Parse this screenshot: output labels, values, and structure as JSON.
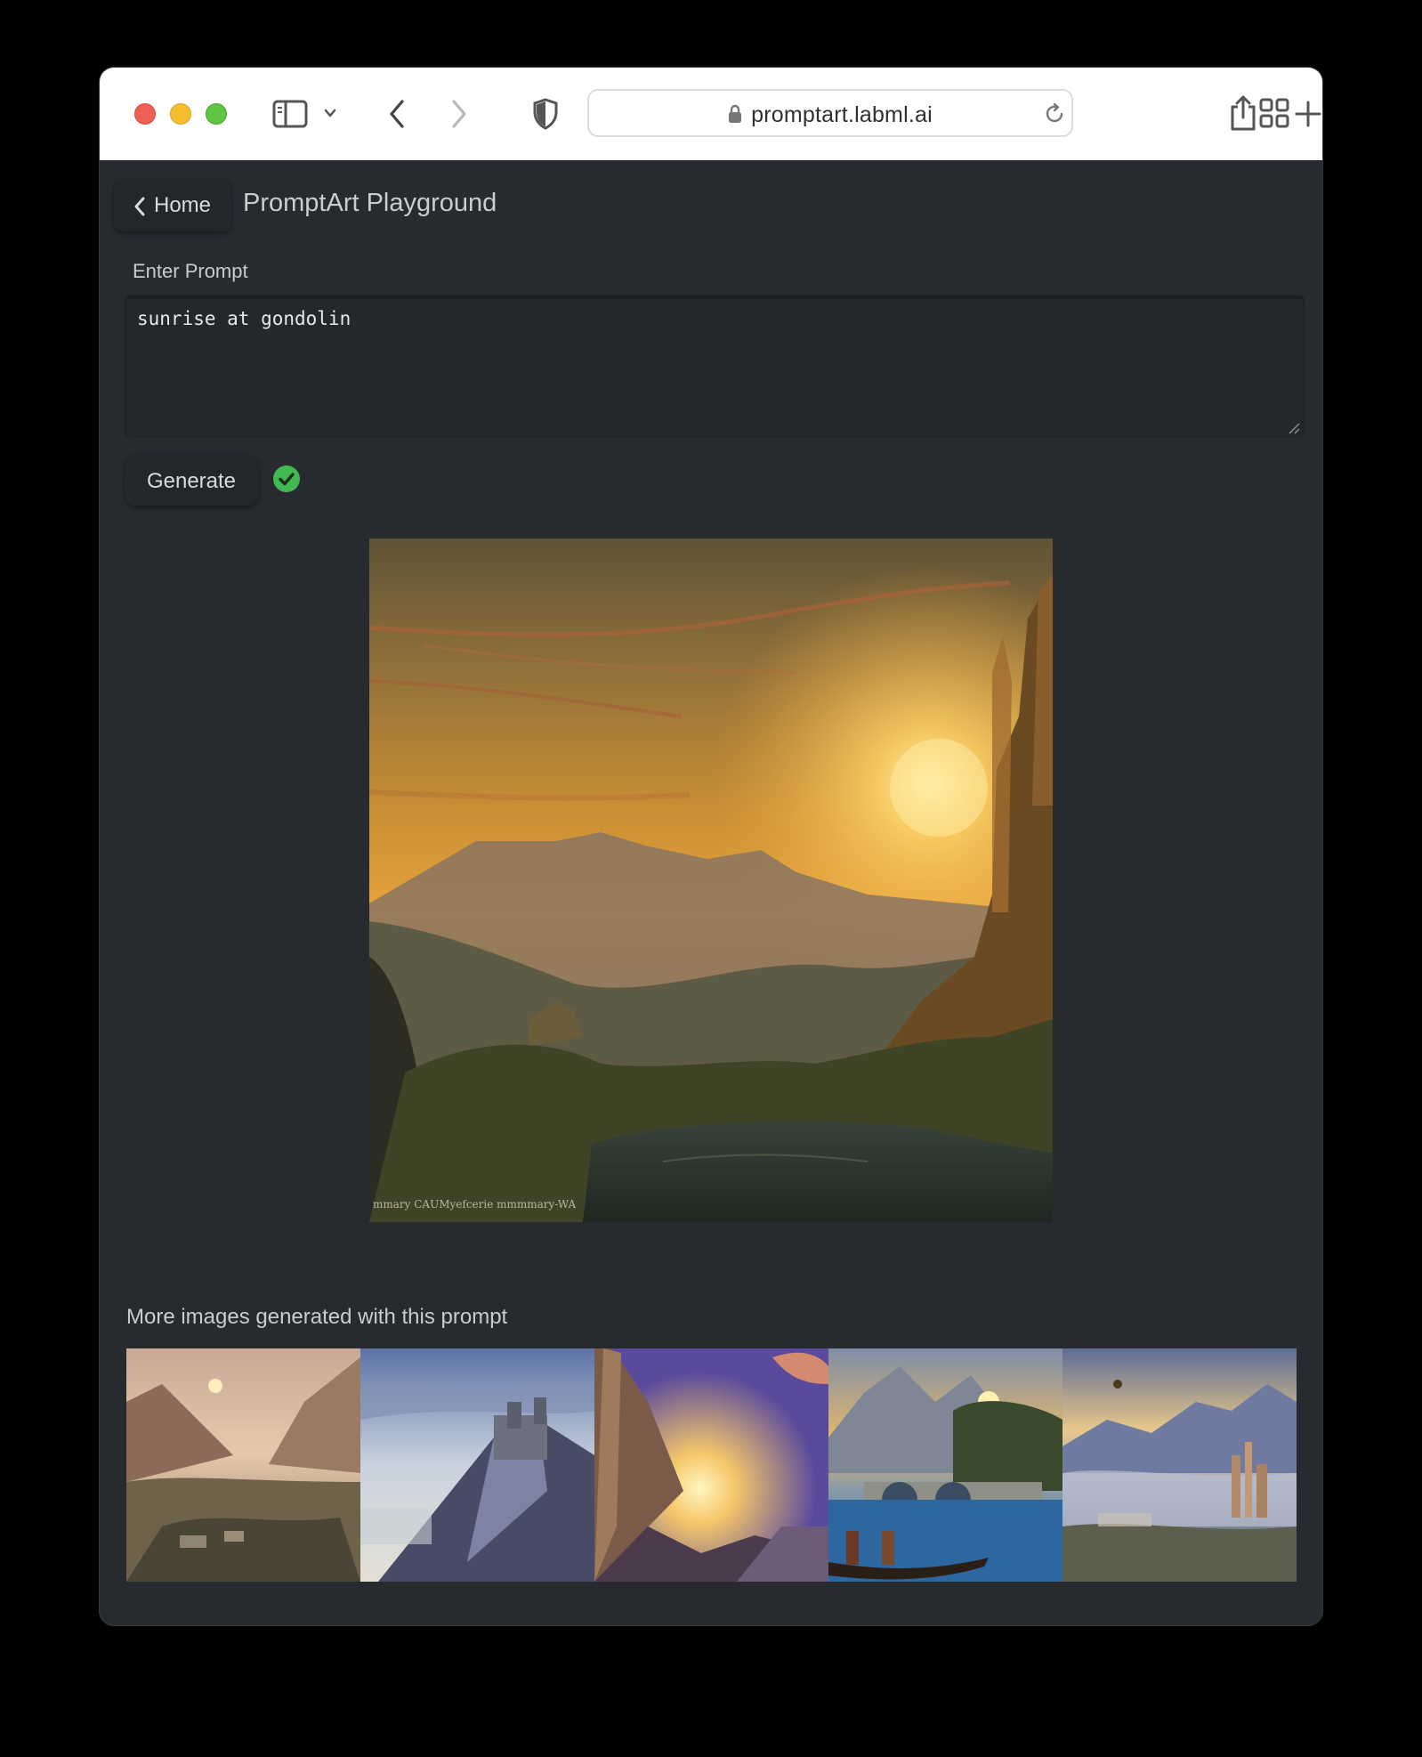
{
  "browser": {
    "url": "promptart.labml.ai"
  },
  "nav": {
    "back_label": "Home",
    "title": "PromptArt Playground"
  },
  "prompt": {
    "label": "Enter Prompt",
    "value": "sunrise at gondolin"
  },
  "generate": {
    "label": "Generate",
    "status": "success"
  },
  "main_image": {
    "signature": "mmary CAUMyefcerie mmmmary-WA"
  },
  "more": {
    "label": "More images generated with this prompt",
    "count": 5
  },
  "colors": {
    "page_bg": "#272b30",
    "success": "#3fb950"
  }
}
